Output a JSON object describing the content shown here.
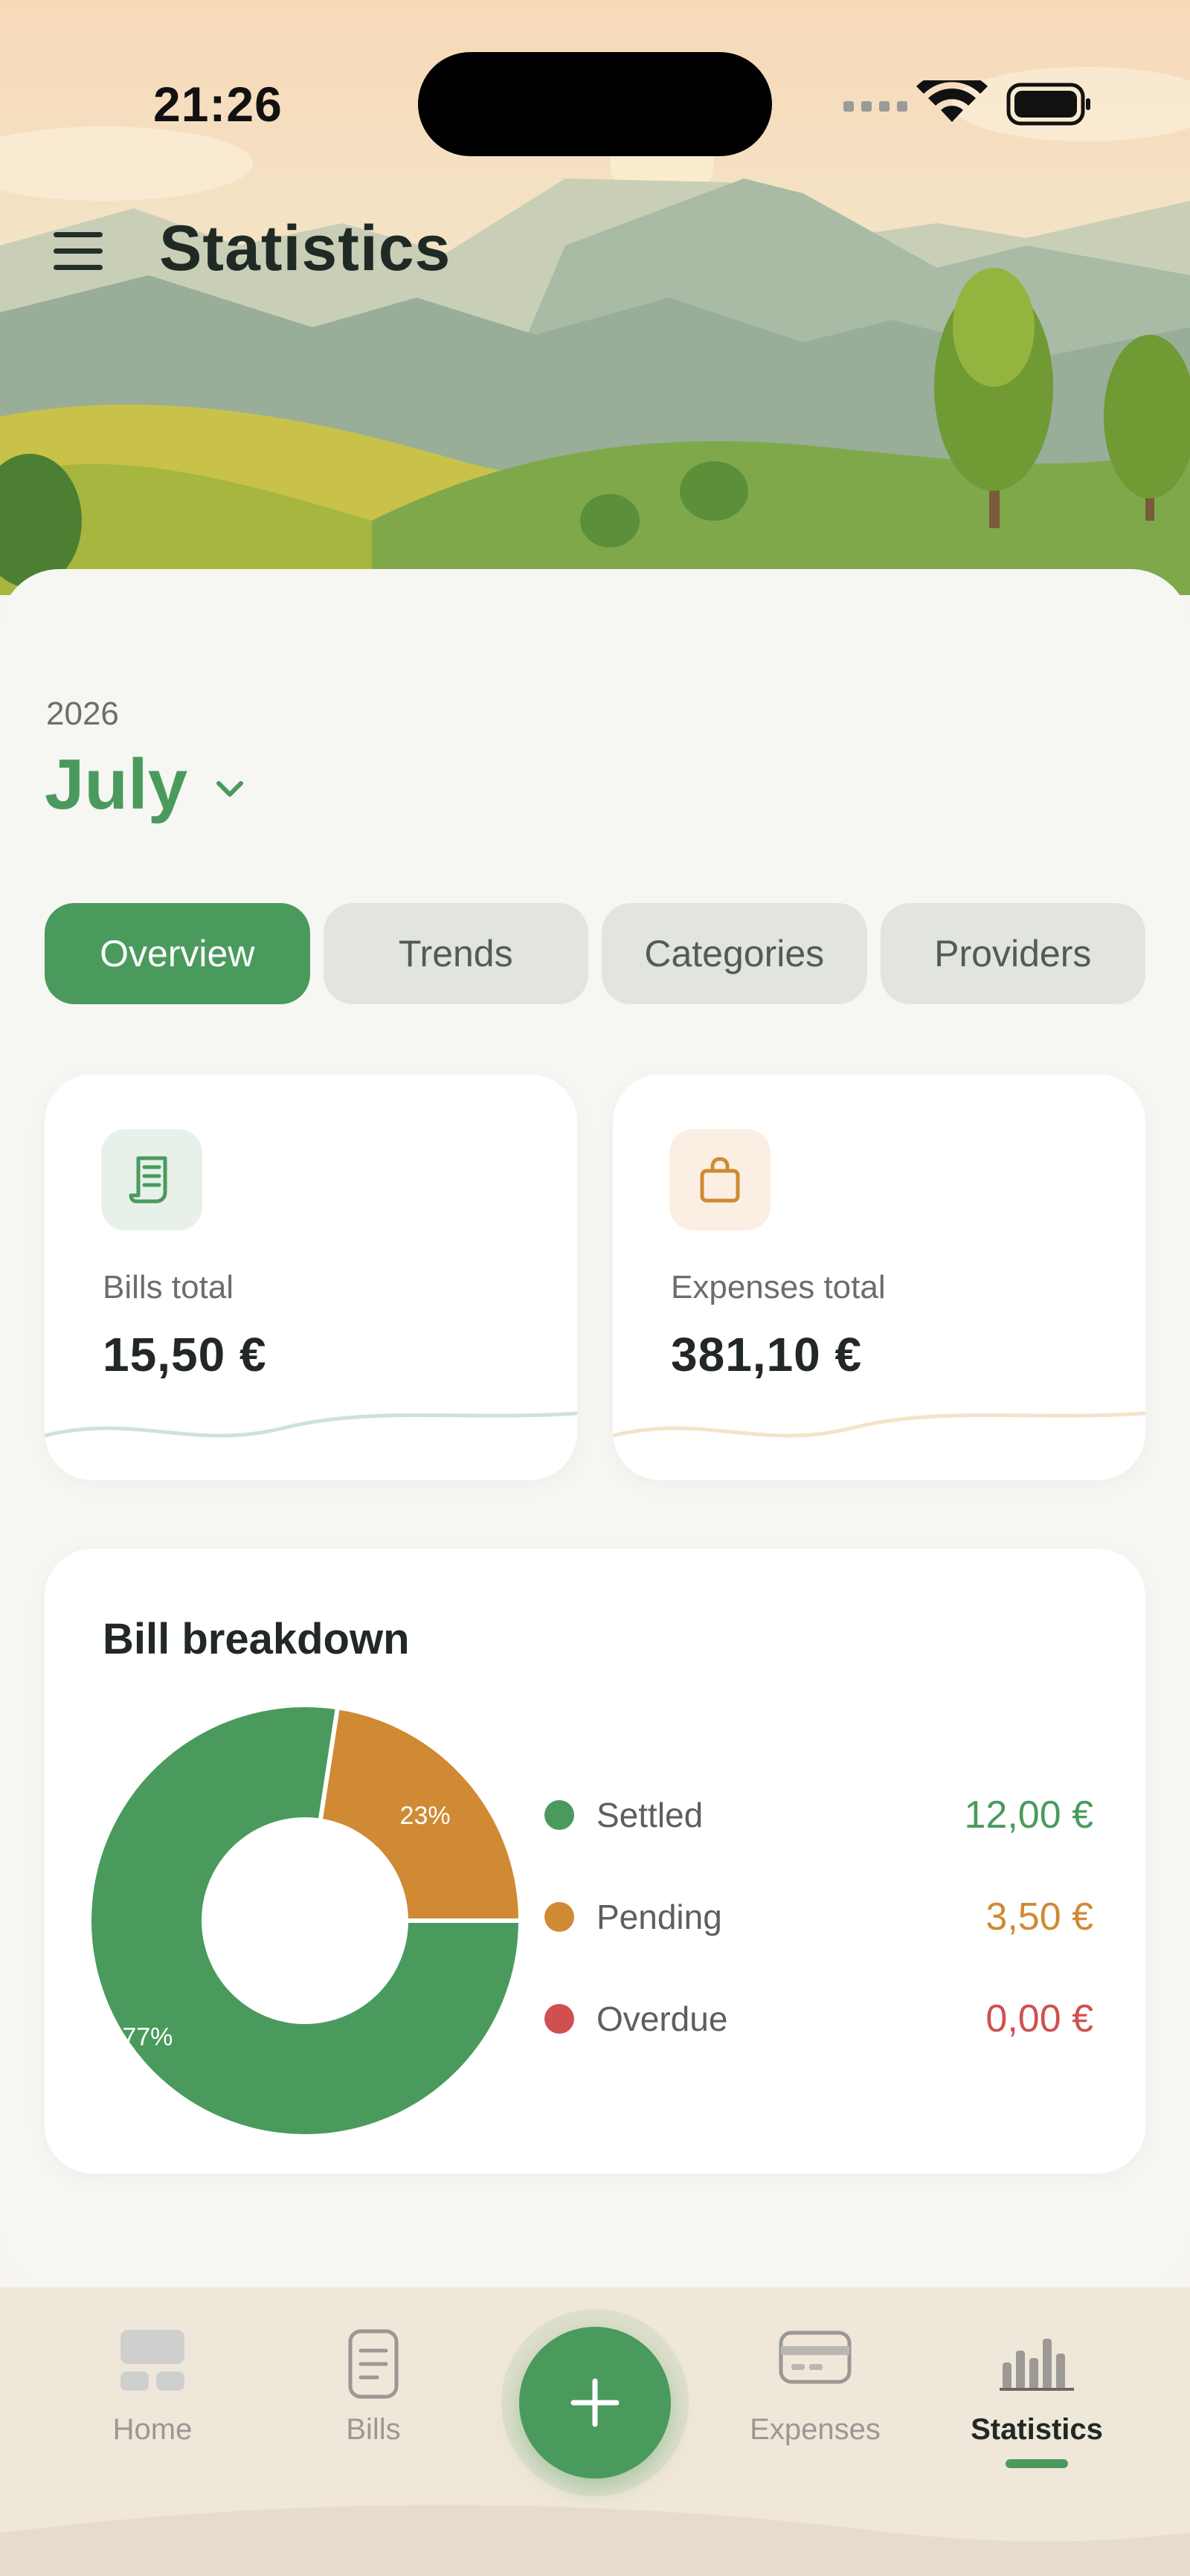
{
  "status_bar": {
    "time": "21:26"
  },
  "header": {
    "title": "Statistics"
  },
  "period": {
    "year": "2026",
    "month": "July"
  },
  "tabs": [
    {
      "label": "Overview",
      "active": true
    },
    {
      "label": "Trends",
      "active": false
    },
    {
      "label": "Categories",
      "active": false
    },
    {
      "label": "Providers",
      "active": false
    }
  ],
  "summary": {
    "bills": {
      "label": "Bills total",
      "value": "15,50 €",
      "icon": "receipt-icon",
      "accent": "#4a9a5d"
    },
    "expenses": {
      "label": "Expenses total",
      "value": "381,10 €",
      "icon": "shopping-bag-icon",
      "accent": "#d08a34"
    }
  },
  "breakdown": {
    "title": "Bill breakdown",
    "items": [
      {
        "label": "Settled",
        "value": "12,00 €",
        "color": "#4a9a5d"
      },
      {
        "label": "Pending",
        "value": "3,50 €",
        "color": "#cf8a33"
      },
      {
        "label": "Overdue",
        "value": "0,00 €",
        "color": "#d05050"
      }
    ]
  },
  "chart_data": {
    "type": "pie",
    "categories": [
      "Settled",
      "Pending",
      "Overdue"
    ],
    "values": [
      12.0,
      3.5,
      0.0
    ],
    "data_labels": [
      "77%",
      "23%"
    ],
    "colors": [
      "#4a9a5d",
      "#cf8a33",
      "#d05050"
    ],
    "title": "Bill breakdown"
  },
  "nav": [
    {
      "label": "Home",
      "icon": "home-icon",
      "active": false
    },
    {
      "label": "Bills",
      "icon": "bills-icon",
      "active": false
    },
    {
      "label": "Expenses",
      "icon": "card-icon",
      "active": false
    },
    {
      "label": "Statistics",
      "icon": "bar-chart-icon",
      "active": true
    }
  ],
  "fab": {
    "icon": "plus-icon"
  }
}
